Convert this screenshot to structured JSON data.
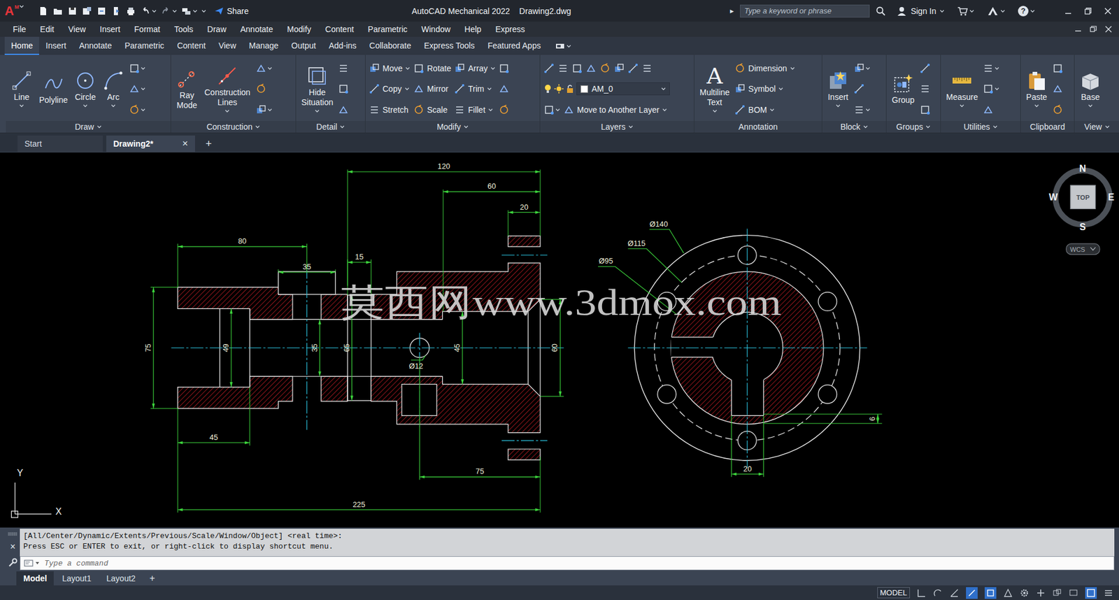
{
  "window": {
    "logo": "A",
    "logo_badge": "M",
    "app_title": "AutoCAD Mechanical 2022",
    "file_title": "Drawing2.dwg",
    "share": "Share",
    "search_arrow": "▸",
    "search_placeholder": "Type a keyword or phrase",
    "sign_in": "Sign In",
    "help": "?"
  },
  "menu": [
    "File",
    "Edit",
    "View",
    "Insert",
    "Format",
    "Tools",
    "Draw",
    "Annotate",
    "Modify",
    "Content",
    "Parametric",
    "Window",
    "Help",
    "Express"
  ],
  "ribbon_tabs": [
    {
      "label": "Home",
      "selected": true
    },
    {
      "label": "Insert",
      "selected": false
    },
    {
      "label": "Annotate",
      "selected": false
    },
    {
      "label": "Parametric",
      "selected": false
    },
    {
      "label": "Content",
      "selected": false
    },
    {
      "label": "View",
      "selected": false
    },
    {
      "label": "Manage",
      "selected": false
    },
    {
      "label": "Output",
      "selected": false
    },
    {
      "label": "Add-ins",
      "selected": false
    },
    {
      "label": "Collaborate",
      "selected": false
    },
    {
      "label": "Express Tools",
      "selected": false
    },
    {
      "label": "Featured Apps",
      "selected": false
    }
  ],
  "ribbon_panels": [
    {
      "title": "Draw",
      "menu": true,
      "columns": [
        [
          [
            {
              "kind": "large",
              "label": "Line",
              "menu": true
            }
          ]
        ],
        [
          [
            {
              "kind": "large",
              "label": "Polyline",
              "menu": false
            }
          ]
        ],
        [
          [
            {
              "kind": "large",
              "label": "Circle",
              "menu": true
            }
          ]
        ],
        [
          [
            {
              "kind": "large",
              "label": "Arc",
              "menu": true
            }
          ]
        ],
        [
          [
            {
              "kind": "icon",
              "menu": true
            }
          ],
          [
            {
              "kind": "icon",
              "menu": true
            }
          ],
          [
            {
              "kind": "icon",
              "menu": true
            }
          ]
        ]
      ]
    },
    {
      "title": "Construction",
      "menu": true,
      "columns": [
        [
          [
            {
              "kind": "large",
              "label": "Ray Mode",
              "menu": false
            }
          ]
        ],
        [
          [
            {
              "kind": "large",
              "label": "Construction Lines",
              "menu": true
            }
          ]
        ],
        [
          [
            {
              "kind": "icon",
              "menu": true
            }
          ],
          [
            {
              "kind": "icon",
              "menu": false
            }
          ],
          [
            {
              "kind": "icon",
              "menu": true
            }
          ]
        ]
      ]
    },
    {
      "title": "Detail",
      "menu": true,
      "columns": [
        [
          [
            {
              "kind": "large",
              "label": "Hide Situation",
              "menu": true
            }
          ]
        ],
        [
          [
            {
              "kind": "icon",
              "menu": false
            }
          ],
          [
            {
              "kind": "icon",
              "menu": false
            }
          ],
          [
            {
              "kind": "icon",
              "menu": false
            }
          ]
        ]
      ]
    },
    {
      "title": "Modify",
      "menu": true,
      "columns": [
        [
          [
            {
              "kind": "small",
              "label": "Move",
              "menu": true
            }
          ],
          [
            {
              "kind": "small",
              "label": "Copy",
              "menu": true
            }
          ],
          [
            {
              "kind": "small",
              "label": "Stretch",
              "menu": false
            }
          ]
        ],
        [
          [
            {
              "kind": "small",
              "label": "Rotate",
              "menu": false
            }
          ],
          [
            {
              "kind": "small",
              "label": "Mirror",
              "menu": false
            }
          ],
          [
            {
              "kind": "small",
              "label": "Scale",
              "menu": false
            }
          ]
        ],
        [
          [
            {
              "kind": "small",
              "label": "Array",
              "menu": true
            }
          ],
          [
            {
              "kind": "small",
              "label": "Trim",
              "menu": true
            }
          ],
          [
            {
              "kind": "small",
              "label": "Fillet",
              "menu": true
            }
          ]
        ],
        [
          [
            {
              "kind": "icon",
              "menu": false
            }
          ],
          [
            {
              "kind": "icon",
              "menu": false
            }
          ],
          [
            {
              "kind": "icon",
              "menu": false
            }
          ]
        ]
      ]
    },
    {
      "title": "Layers",
      "menu": true,
      "columns": [
        [
          [
            {
              "kind": "icon",
              "menu": false
            },
            {
              "kind": "icon",
              "menu": false
            },
            {
              "kind": "icon",
              "menu": false
            },
            {
              "kind": "icon",
              "menu": false
            },
            {
              "kind": "icon",
              "menu": false
            },
            {
              "kind": "icon",
              "menu": false
            },
            {
              "kind": "icon",
              "menu": false
            },
            {
              "kind": "icon",
              "menu": false
            }
          ],
          [
            {
              "kind": "layer",
              "label": "AM_0",
              "menu": true
            }
          ],
          [
            {
              "kind": "icon",
              "menu": true
            },
            {
              "kind": "small",
              "label": "Move to Another Layer",
              "menu": true
            }
          ]
        ]
      ]
    },
    {
      "title": "Annotation",
      "menu": false,
      "columns": [
        [
          [
            {
              "kind": "large",
              "label": "Multiline Text",
              "menu": true,
              "glyph": "A"
            }
          ]
        ],
        [
          [
            {
              "kind": "small",
              "label": "Dimension",
              "menu": true
            }
          ],
          [
            {
              "kind": "small",
              "label": "Symbol",
              "menu": true
            }
          ],
          [
            {
              "kind": "small",
              "label": "BOM",
              "menu": true
            }
          ]
        ]
      ]
    },
    {
      "title": "Block",
      "menu": true,
      "columns": [
        [
          [
            {
              "kind": "large",
              "label": "Insert",
              "menu": true
            }
          ]
        ],
        [
          [
            {
              "kind": "icon",
              "menu": true
            }
          ],
          [
            {
              "kind": "icon",
              "menu": false
            }
          ],
          [
            {
              "kind": "icon",
              "menu": true
            }
          ]
        ]
      ]
    },
    {
      "title": "Groups",
      "menu": true,
      "columns": [
        [
          [
            {
              "kind": "large",
              "label": "Group",
              "menu": false
            }
          ]
        ],
        [
          [
            {
              "kind": "icon",
              "menu": false
            }
          ],
          [
            {
              "kind": "icon",
              "menu": false
            }
          ],
          [
            {
              "kind": "icon",
              "menu": false
            }
          ]
        ]
      ]
    },
    {
      "title": "Utilities",
      "menu": true,
      "columns": [
        [
          [
            {
              "kind": "large",
              "label": "Measure",
              "menu": true
            }
          ]
        ],
        [
          [
            {
              "kind": "icon",
              "menu": true
            }
          ],
          [
            {
              "kind": "icon",
              "menu": true
            }
          ],
          [
            {
              "kind": "icon",
              "menu": false
            }
          ]
        ]
      ]
    },
    {
      "title": "Clipboard",
      "menu": false,
      "columns": [
        [
          [
            {
              "kind": "large",
              "label": "Paste",
              "menu": true
            }
          ]
        ],
        [
          [
            {
              "kind": "icon",
              "menu": false
            }
          ],
          [
            {
              "kind": "icon",
              "menu": false
            }
          ],
          [
            {
              "kind": "icon",
              "menu": false
            }
          ]
        ]
      ]
    },
    {
      "title": "View",
      "menu": true,
      "columns": [
        [
          [
            {
              "kind": "large",
              "label": "Base",
              "menu": true
            }
          ]
        ]
      ]
    }
  ],
  "file_tabs": [
    {
      "label": "Start",
      "selected": false,
      "closable": false
    },
    {
      "label": "Drawing2*",
      "selected": true,
      "closable": true
    }
  ],
  "file_tab_close": "×",
  "new_tab": "+",
  "canvas": {
    "section_view": {
      "dimensions": [
        "120",
        "60",
        "20",
        "80",
        "35",
        "15",
        "75",
        "49",
        "35",
        "65",
        "45",
        "60",
        "Ø12",
        "45",
        "75",
        "225"
      ]
    },
    "end_view": {
      "dimensions": [
        "Ø140",
        "Ø115",
        "Ø95",
        "6",
        "20"
      ]
    },
    "watermark": "莫西网www.3dmox.com",
    "viewcube": {
      "north": "N",
      "south": "S",
      "east": "E",
      "west": "W",
      "face": "TOP",
      "ucs": "WCS"
    },
    "ucs_icon": {
      "y": "Y",
      "x": "X"
    }
  },
  "command": {
    "close": "×",
    "history": [
      "[All/Center/Dynamic/Extents/Previous/Scale/Window/Object] <real time>:",
      "Press ESC or ENTER to exit, or right-click to display shortcut menu."
    ],
    "placeholder": "Type a command"
  },
  "layout_tabs": [
    {
      "label": "Model",
      "selected": true
    },
    {
      "label": "Layout1",
      "selected": false
    },
    {
      "label": "Layout2",
      "selected": false
    }
  ],
  "layout_add": "+",
  "status_bar": {
    "mode": "MODEL"
  }
}
